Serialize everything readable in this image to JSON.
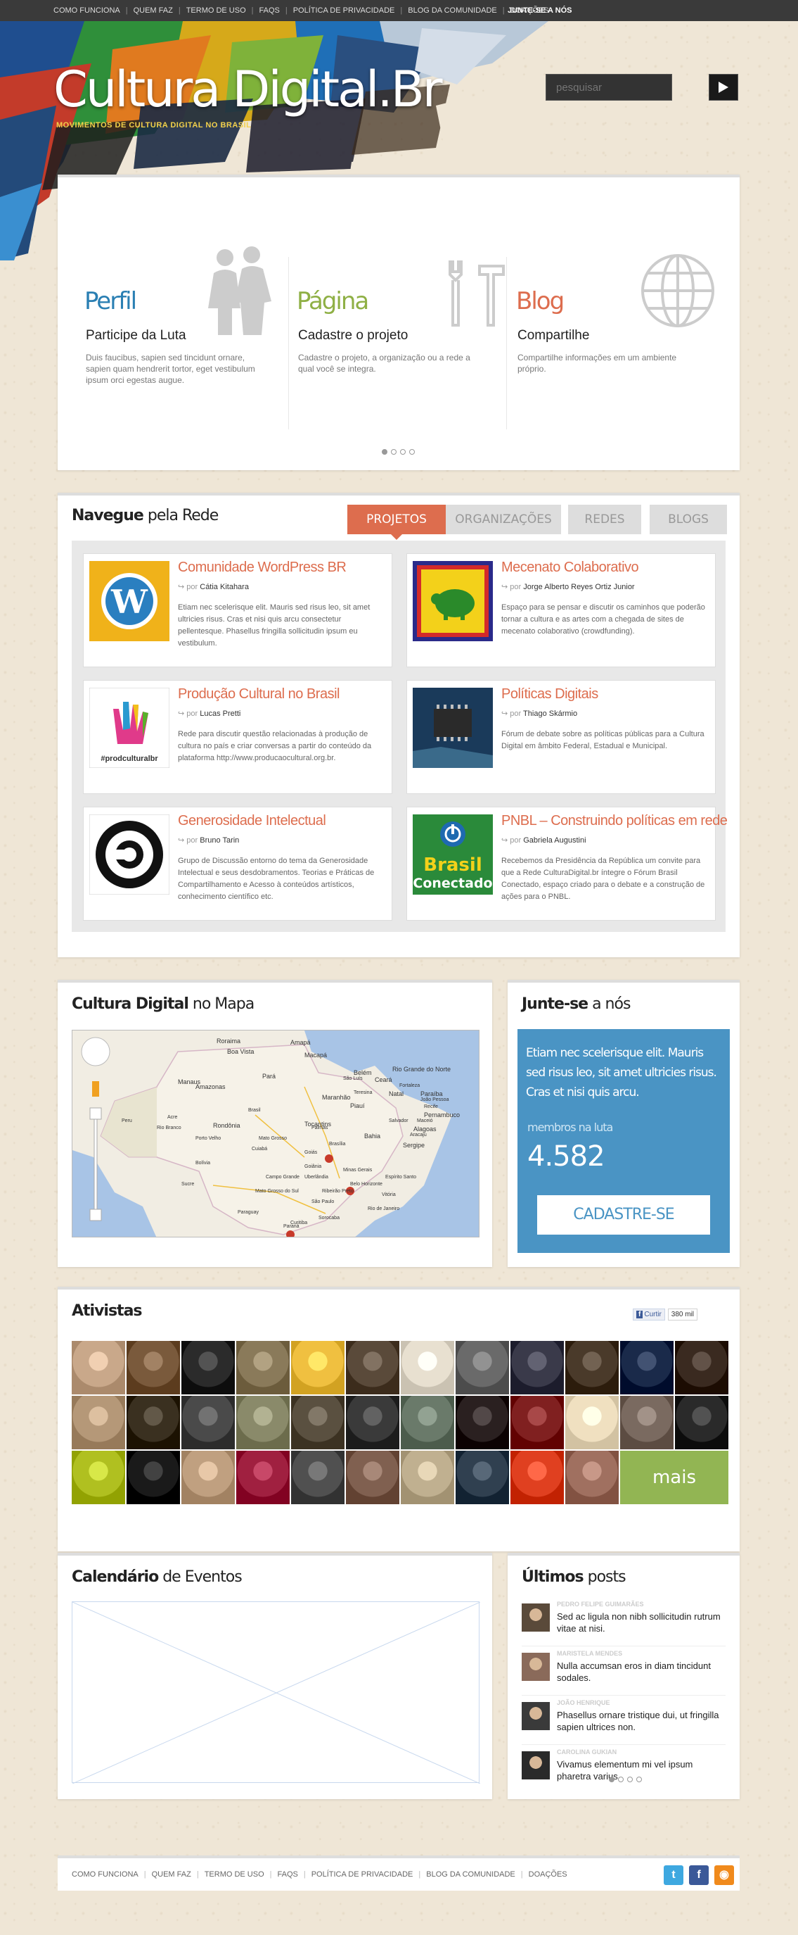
{
  "topnav": {
    "links": [
      "COMO FUNCIONA",
      "QUEM FAZ",
      "TERMO DE USO",
      "FAQS",
      "POLÍTICA DE PRIVACIDADE",
      "BLOG DA COMUNIDADE",
      "DOAÇÕES"
    ],
    "join": "JUNTE-SE A NÓS"
  },
  "header": {
    "logo": "Cultura Digital.Br",
    "tagline": "MOVIMENTOS DE CULTURA DIGITAL NO BRASIL",
    "search_placeholder": "pesquisar"
  },
  "slider": {
    "items": [
      {
        "head": "Perfil",
        "sub": "Participe da Luta",
        "desc": "Duis faucibus, sapien sed tincidunt ornare, sapien quam hendrerit tortor, eget vestibulum ipsum orci egestas augue.",
        "color": "#2a7fb3",
        "icon": "people-icon"
      },
      {
        "head": "Página",
        "sub": "Cadastre o projeto",
        "desc": "Cadastre o projeto, a organização ou a rede a qual você se integra.",
        "color": "#8fb045",
        "icon": "tools-icon"
      },
      {
        "head": "Blog",
        "sub": "Compartilhe",
        "desc": "Compartilhe informações em um ambiente próprio.",
        "color": "#dd6d4e",
        "icon": "globe-icon"
      }
    ],
    "pages": 4,
    "active_page": 1
  },
  "network": {
    "title_bold": "Navegue",
    "title_rest": " pela Rede",
    "tabs": [
      "PROJETOS",
      "ORGANIZAÇÕES",
      "REDES",
      "BLOGS"
    ],
    "active_tab": 0,
    "by_prefix": "por",
    "cards": [
      {
        "title": "Comunidade WordPress BR",
        "author": "Cátia Kitahara",
        "desc": "Etiam nec scelerisque elit. Mauris sed risus leo, sit amet ultricies risus. Cras et nisi quis arcu consectetur pellentesque. Phasellus fringilla sollicitudin ipsum eu vestibulum.",
        "thumb": "wordpress-logo"
      },
      {
        "title": "Mecenato Colaborativo",
        "author": "Jorge Alberto Reyes Ortiz Junior",
        "desc": "Espaço para se pensar e discutir os caminhos que poderão tornar a cultura e as artes com a chegada de sites de mecenato colaborativo (crowdfunding).",
        "thumb": "piggy-bank-logo"
      },
      {
        "title": "Produção Cultural no Brasil",
        "author": "Lucas Pretti",
        "desc": "Rede para discutir questão relacionadas à produção de cultura no país e criar conversas a partir do conteúdo da plataforma http://www.producaocultural.org.br.",
        "thumb": "hand-logo",
        "thumb_text": "#prodculturalbr"
      },
      {
        "title": "Políticas Digitais",
        "author": "Thiago Skármio",
        "desc": "Fórum de debate sobre as políticas públicas para a Cultura Digital em âmbito Federal, Estadual e Municipal.",
        "thumb": "chip-photo"
      },
      {
        "title": "Generosidade Intelectual",
        "author": "Bruno Tarin",
        "desc": "Grupo de Discussão entorno do tema da Generosidade Intelectual e seus desdobramentos. Teorias e Práticas de Compartilhamento e Acesso à conteúdos artísticos, conhecimento científico etc.",
        "thumb": "copyleft-logo"
      },
      {
        "title": "PNBL – Construindo políticas em rede",
        "author": "Gabriela Augustini",
        "desc": "Recebemos da Presidência da República um convite para que a Rede CulturaDigital.br íntegre o Fórum Brasil Conectado, espaço criado para o debate e a construção de ações para o PNBL.",
        "thumb": "brasil-conectado-logo",
        "thumb_text_1": "Brasil",
        "thumb_text_2": "Conectado"
      }
    ]
  },
  "map": {
    "title_bold": "Cultura Digital",
    "title_rest": " no Mapa",
    "labels": [
      "Roraima",
      "Amapá",
      "Boa Vista",
      "Macapá",
      "Belém",
      "Manaus",
      "Amazonas",
      "Pará",
      "Maranhão",
      "Ceará",
      "Rio Grande do Norte",
      "Natal",
      "Paraíba",
      "Pernambuco",
      "Alagoas",
      "Sergipe",
      "Bahia",
      "Piauí",
      "Tocantins",
      "Rondônia",
      "Acre",
      "Peru",
      "Mato Grosso",
      "Bolívia",
      "Goiás",
      "Brasília",
      "Minas Gerais",
      "Mato Grosso do Sul",
      "São Paulo",
      "Rio de Janeiro",
      "Paraguay",
      "Paraná",
      "Cuiabá",
      "Campo Grande",
      "Belo Horizonte",
      "Espírito Santo",
      "Vitória",
      "Aracaju",
      "Maceió",
      "Recife",
      "João Pessoa",
      "Fortaleza",
      "Teresina",
      "São Luís",
      "Palmas",
      "Salvador",
      "Goiânia",
      "Uberlândia",
      "Ribeirão Preto",
      "Curitiba",
      "Sorocaba",
      "Sucre",
      "Brasil",
      "Rio Branco",
      "Porto Velho"
    ]
  },
  "join": {
    "title_bold": "Junte-se",
    "title_rest": " a nós",
    "text": "Etiam nec scelerisque elit. Mauris sed risus leo, sit amet ultricies risus. Cras et nisi quis arcu.",
    "members_label": "membros na luta",
    "members_count": "4.582",
    "button": "CADASTRE-SE"
  },
  "activists": {
    "title": "Ativistas",
    "like_label": "Curtir",
    "like_count": "380 mil",
    "more": "mais",
    "avatar_colors": [
      "#c9a88a",
      "#7a5a3c",
      "#2b2b2b",
      "#8a7a5a",
      "#f0c040",
      "#5a4a3a",
      "#e8e0d0",
      "#6a6a6a",
      "#3a3a4a",
      "#4a3a2a",
      "#1a2a4a",
      "#3a2a20",
      "#b59878",
      "#3a3020",
      "#4a4a4a",
      "#8a8a6a",
      "#5a5040",
      "#3a3a3a",
      "#6a7a6a",
      "#2a2020",
      "#802020",
      "#f0e0c0",
      "#7a6a60",
      "#2a2a2a",
      "#b0c020",
      "#1a1a1a",
      "#c0a080",
      "#a02040",
      "#505050",
      "#806050",
      "#c0b090",
      "#304050",
      "#e04020",
      "#a07060"
    ]
  },
  "calendar": {
    "title_bold": "Calendário",
    "title_rest": " de Eventos"
  },
  "posts": {
    "title_bold": "Últimos",
    "title_rest": " posts",
    "items": [
      {
        "author": "PEDRO FELIPE GUIMARÃES",
        "text": "Sed ac ligula non nibh sollicitudin rutrum vitae at nisi."
      },
      {
        "author": "MARISTELA MENDES",
        "text": "Nulla accumsan eros in diam tincidunt sodales."
      },
      {
        "author": "JOÃO HENRIQUE",
        "text": "Phasellus ornare tristique dui, ut fringilla sapien ultrices non."
      },
      {
        "author": "CAROLINA GUKIAN",
        "text": "Vivamus elementum mi vel ipsum pharetra varius."
      }
    ],
    "pages": 4,
    "active_page": 1
  },
  "footer": {
    "links": [
      "COMO FUNCIONA",
      "QUEM FAZ",
      "TERMO DE USO",
      "FAQS",
      "POLÍTICA DE PRIVACIDADE",
      "BLOG DA COMUNIDADE",
      "DOAÇÕES"
    ],
    "social": [
      {
        "name": "twitter-icon",
        "glyph": "t",
        "color": "#3ea8e0"
      },
      {
        "name": "facebook-icon",
        "glyph": "f",
        "color": "#3b5998"
      },
      {
        "name": "rss-icon",
        "glyph": "◉",
        "color": "#f08a1c"
      }
    ]
  }
}
